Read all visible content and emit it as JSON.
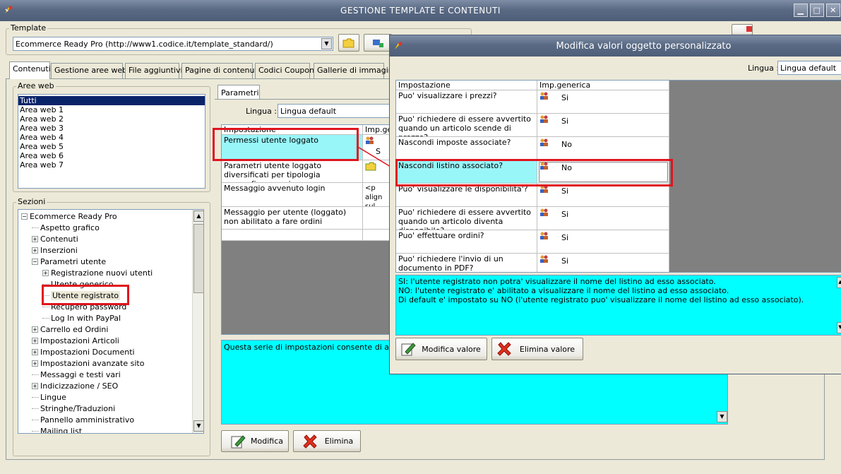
{
  "window": {
    "title": "GESTIONE TEMPLATE E CONTENUTI"
  },
  "template_group": {
    "label": "Template",
    "value": "Ecommerce Ready Pro (http://www1.codice.it/template_standard/)"
  },
  "tabs": [
    "Contenuti",
    "Gestione aree web",
    "File aggiuntivi",
    "Pagine di contenuti",
    "Codici Coupon",
    "Gallerie di immagini"
  ],
  "aree_web": {
    "label": "Aree web",
    "items": [
      "Tutti",
      "Area web 1",
      "Area web 2",
      "Area web 3",
      "Area web 4",
      "Area web 5",
      "Area web 6",
      "Area web 7"
    ],
    "selected": 0
  },
  "sezioni": {
    "label": "Sezioni",
    "nodes": [
      {
        "label": "Ecommerce Ready Pro",
        "exp": "−"
      },
      {
        "label": "Aspetto grafico",
        "exp": ""
      },
      {
        "label": "Contenuti",
        "exp": "+"
      },
      {
        "label": "Inserzioni",
        "exp": "+"
      },
      {
        "label": "Parametri utente",
        "exp": "−"
      },
      {
        "label": "Registrazione nuovi utenti",
        "exp": "+"
      },
      {
        "label": "Utente generico",
        "exp": ""
      },
      {
        "label": "Utente registrato",
        "exp": ""
      },
      {
        "label": "Recupero password",
        "exp": ""
      },
      {
        "label": "Log In with PayPal",
        "exp": ""
      },
      {
        "label": "Carrello ed Ordini",
        "exp": "+"
      },
      {
        "label": "Impostazioni Articoli",
        "exp": "+"
      },
      {
        "label": "Impostazioni Documenti",
        "exp": "+"
      },
      {
        "label": "Impostazioni avanzate sito",
        "exp": "+"
      },
      {
        "label": "Messaggi e testi vari",
        "exp": ""
      },
      {
        "label": "Indicizzazione / SEO",
        "exp": "+"
      },
      {
        "label": "Lingue",
        "exp": ""
      },
      {
        "label": "Stringhe/Traduzioni",
        "exp": ""
      },
      {
        "label": "Pannello amministrativo",
        "exp": ""
      },
      {
        "label": "Mailing list",
        "exp": ""
      }
    ]
  },
  "parametri": {
    "tab": "Parametri",
    "lingua_label": "Lingua :",
    "lingua_value": "Lingua default",
    "columns": [
      "Impostazione",
      "Imp.generica"
    ],
    "rows": [
      {
        "name": "Permessi utente loggato",
        "value": "S"
      },
      {
        "name": "Parametri utente loggato diversificati per tipologia anagrafica e nazione",
        "value": ""
      },
      {
        "name": "Messaggio avvenuto login",
        "value": "<p align sul nost"
      },
      {
        "name": "Messaggio per utente (loggato) non abilitato a fare ordini",
        "value": ""
      }
    ],
    "description": "Questa serie di impostazioni consente di assegnar",
    "btn_modifica": "Modifica",
    "btn_elimina": "Elimina"
  },
  "dialog": {
    "title": "Modifica valori oggetto personalizzato",
    "lingua_label": "Lingua :",
    "lingua_value": "Lingua default",
    "columns": [
      "Impostazione",
      "Imp.generica"
    ],
    "rows": [
      {
        "name": "Puo' visualizzare i prezzi?",
        "value": "Si"
      },
      {
        "name": "Puo' richiedere di essere avvertito quando un articolo scende di prezzo?",
        "value": "Si"
      },
      {
        "name": "Nascondi imposte associate?",
        "value": "No"
      },
      {
        "name": "Nascondi listino associato?",
        "value": "No"
      },
      {
        "name": "Puo' visualizzare le disponibilita'?",
        "value": "Si"
      },
      {
        "name": "Puo' richiedere di essere avvertito quando un articolo diventa disponibile?",
        "value": "Si"
      },
      {
        "name": "Puo' effettuare ordini?",
        "value": "Si"
      },
      {
        "name": "Puo' richiedere l'invio di un documento in PDF?",
        "value": "Si"
      }
    ],
    "info": [
      "SI: l'utente registrato non potra' visualizzare il nome del listino ad esso associato.",
      "NO: l'utente registrato e' abilitato a visualizzare il nome del listino ad esso associato.",
      "Di default e' impostato su NO (l'utente registrato puo' visualizzare il nome del listino ad esso associato)."
    ],
    "btn_modifica": "Modifica valore",
    "btn_elimina": "Elimina valore"
  },
  "colors": {
    "accent_cyan": "#98f6f9",
    "info_cyan": "#00ffff",
    "highlight_red": "#e0141e",
    "selection_blue": "#0a246a"
  }
}
